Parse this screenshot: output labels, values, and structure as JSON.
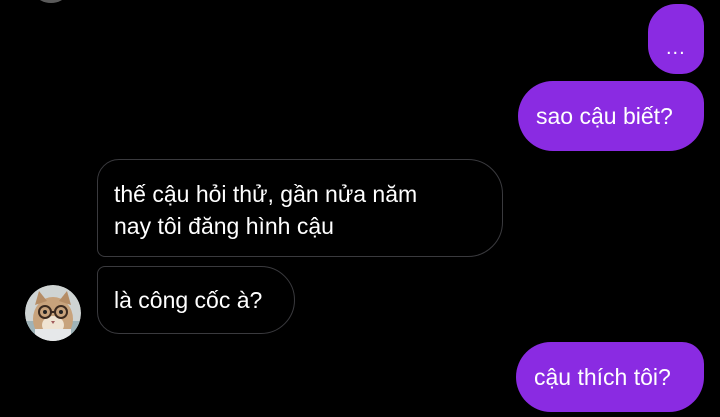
{
  "messages": [
    {
      "side": "sent",
      "text": "..."
    },
    {
      "side": "sent",
      "text": "sao cậu biết?"
    },
    {
      "side": "received",
      "line1": "thế cậu hỏi thử, gần nửa năm",
      "line2": "nay tôi đăng hình cậu"
    },
    {
      "side": "received",
      "text": "là công cốc à?"
    },
    {
      "side": "sent",
      "text": "cậu thích tôi?"
    }
  ],
  "colors": {
    "background": "#000000",
    "sent_bubble": "#8a2be2",
    "received_border": "#3a3a3e",
    "text": "#ffffff"
  },
  "avatar": {
    "icon": "cat-with-glasses-avatar"
  }
}
